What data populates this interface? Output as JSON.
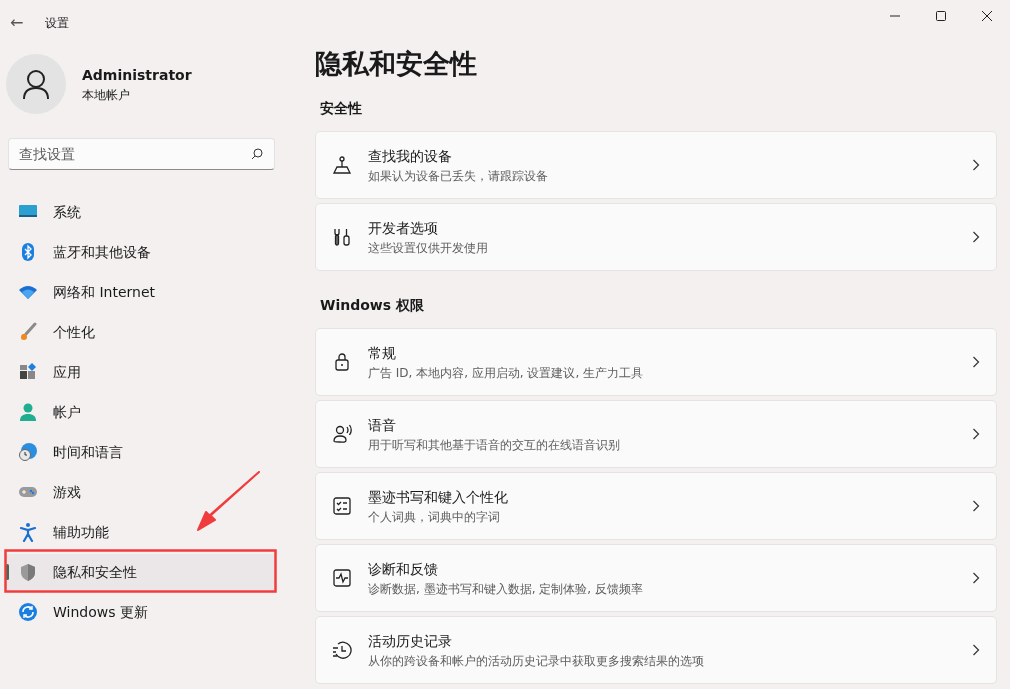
{
  "window": {
    "title": "设置",
    "back": "←"
  },
  "user": {
    "name": "Administrator",
    "account": "本地帐户"
  },
  "search": {
    "placeholder": "查找设置"
  },
  "sidebar": {
    "items": [
      {
        "label": "系统",
        "selected": false
      },
      {
        "label": "蓝牙和其他设备",
        "selected": false
      },
      {
        "label": "网络和 Internet",
        "selected": false
      },
      {
        "label": "个性化",
        "selected": false
      },
      {
        "label": "应用",
        "selected": false
      },
      {
        "label": "帐户",
        "selected": false
      },
      {
        "label": "时间和语言",
        "selected": false
      },
      {
        "label": "游戏",
        "selected": false
      },
      {
        "label": "辅助功能",
        "selected": false
      },
      {
        "label": "隐私和安全性",
        "selected": true
      },
      {
        "label": "Windows 更新",
        "selected": false
      }
    ]
  },
  "page": {
    "title": "隐私和安全性",
    "sections": [
      {
        "heading": "安全性",
        "items": [
          {
            "title": "查找我的设备",
            "description": "如果认为设备已丢失，请跟踪设备"
          },
          {
            "title": "开发者选项",
            "description": "这些设置仅供开发使用"
          }
        ]
      },
      {
        "heading": "Windows 权限",
        "items": [
          {
            "title": "常规",
            "description": "广告 ID, 本地内容, 应用启动, 设置建议, 生产力工具"
          },
          {
            "title": "语音",
            "description": "用于听写和其他基于语音的交互的在线语音识别"
          },
          {
            "title": "墨迹书写和键入个性化",
            "description": "个人词典，词典中的字词"
          },
          {
            "title": "诊断和反馈",
            "description": "诊断数据, 墨迹书写和键入数据, 定制体验, 反馈频率"
          },
          {
            "title": "活动历史记录",
            "description": "从你的跨设备和帐户的活动历史记录中获取更多搜索结果的选项"
          }
        ]
      }
    ]
  }
}
